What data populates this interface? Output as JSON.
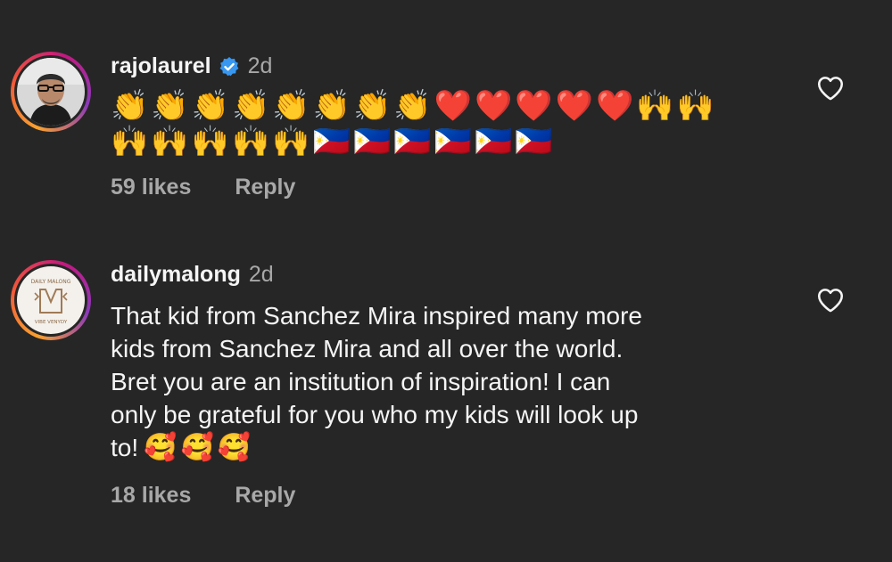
{
  "comments": [
    {
      "username": "rajolaurel",
      "verified": true,
      "time": "2d",
      "emoji_line_1": "👏👏👏👏👏👏👏👏❤️❤️❤️❤️❤️🙌🙌",
      "emoji_line_2": "🙌🙌🙌🙌🙌🇵🇭🇵🇭🇵🇭🇵🇭🇵🇭🇵🇭",
      "likes": "59 likes",
      "reply_label": "Reply"
    },
    {
      "username": "dailymalong",
      "verified": false,
      "time": "2d",
      "text_lines": [
        "That kid from Sanchez Mira inspired many more",
        "kids from Sanchez Mira and all over the world.",
        "Bret you are an institution of inspiration!  I can",
        "only be grateful for you who my kids will look up",
        "to!"
      ],
      "trailing_emoji": "🥰🥰🥰",
      "likes": "18 likes",
      "reply_label": "Reply",
      "avatar_logo_top": "DAILY MALONG",
      "avatar_logo_bottom": "VIBE VENYDY"
    }
  ],
  "icons": {
    "like": "heart-outline-icon",
    "verified": "verified-badge-icon"
  },
  "colors": {
    "background": "#262626",
    "text": "#f5f5f5",
    "muted": "#a8a8a8",
    "verified_blue": "#3897f0"
  }
}
